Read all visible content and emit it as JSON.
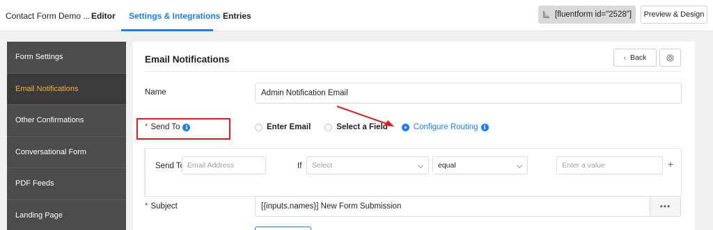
{
  "topbar": {
    "form_title": "Contact Form Demo ...",
    "tabs": [
      {
        "label": "Editor"
      },
      {
        "label": "Settings & Integrations"
      },
      {
        "label": "Entries"
      }
    ],
    "shortcode": "[fluentform id=\"2528\"]",
    "preview_label": "Preview & Design"
  },
  "sidebar": {
    "items": [
      {
        "label": "Form Settings"
      },
      {
        "label": "Email Notifications"
      },
      {
        "label": "Other Confirmations"
      },
      {
        "label": "Conversational Form"
      },
      {
        "label": "PDF Feeds"
      },
      {
        "label": "Landing Page"
      }
    ],
    "active_index": 1
  },
  "main": {
    "title": "Email Notifications",
    "back_label": "Back",
    "name_label": "Name",
    "name_value": "Admin Notification Email",
    "send_to_label": "Send To",
    "send_to_options": [
      {
        "label": "Enter Email",
        "checked": false
      },
      {
        "label": "Select a Field",
        "checked": false
      },
      {
        "label": "Configure Routing",
        "checked": true
      }
    ],
    "routing": {
      "send_to_label": "Send To",
      "email_placeholder": "Email Address",
      "if_label": "If",
      "field_placeholder": "Select",
      "operator_value": "equal",
      "value_placeholder": "Enter a value",
      "add_symbol": "+"
    },
    "subject_label": "Subject",
    "subject_value": "[{inputs.names}] New Form Submission",
    "subject_more": "•••"
  },
  "colors": {
    "accent": "#1a7efb",
    "sidebar_bg": "#4b4c4d",
    "sidebar_active_text": "#f4b430",
    "annotation": "#e01b1b"
  }
}
